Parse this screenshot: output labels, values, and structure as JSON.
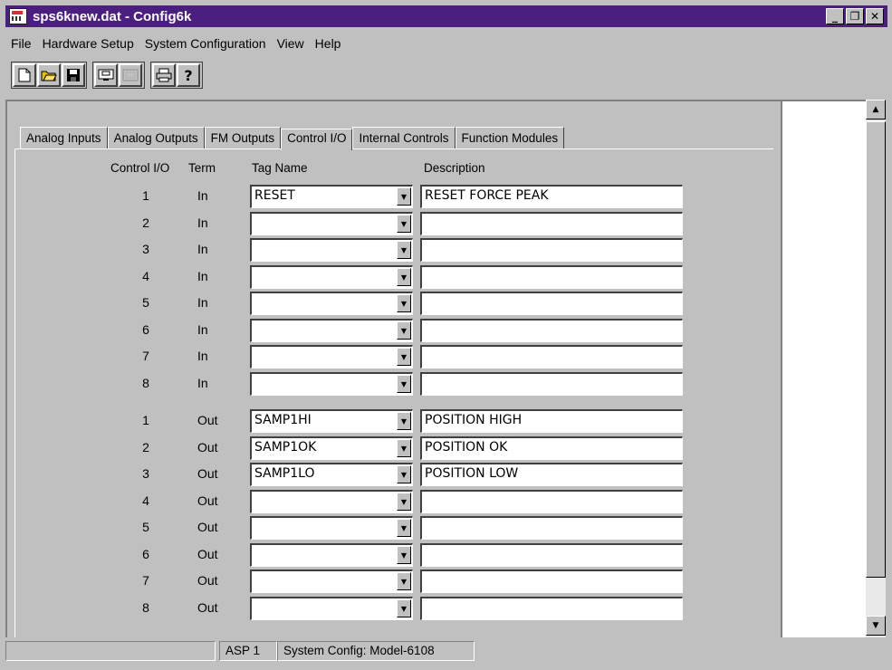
{
  "window": {
    "title": "sps6knew.dat - Config6k",
    "controls": [
      "_",
      "❐",
      "✕"
    ]
  },
  "menu": [
    "File",
    "Hardware Setup",
    "System Configuration",
    "View",
    "Help"
  ],
  "toolbar": {
    "buttons": [
      "new-icon",
      "open-icon",
      "save-icon",
      "monitor-icon",
      "disabled-icon",
      "print-icon",
      "help-icon"
    ]
  },
  "tabs": [
    "Analog Inputs",
    "Analog Outputs",
    "FM Outputs",
    "Control I/O",
    "Internal Controls",
    "Function Modules"
  ],
  "active_tab": "Control I/O",
  "table": {
    "headers": {
      "control": "Control I/O",
      "term": "Term",
      "tag": "Tag Name",
      "description": "Description"
    },
    "rows": [
      {
        "num": "1",
        "term": "In",
        "tag": "RESET",
        "desc": "RESET FORCE PEAK"
      },
      {
        "num": "2",
        "term": "In",
        "tag": "",
        "desc": ""
      },
      {
        "num": "3",
        "term": "In",
        "tag": "",
        "desc": ""
      },
      {
        "num": "4",
        "term": "In",
        "tag": "",
        "desc": ""
      },
      {
        "num": "5",
        "term": "In",
        "tag": "",
        "desc": ""
      },
      {
        "num": "6",
        "term": "In",
        "tag": "",
        "desc": ""
      },
      {
        "num": "7",
        "term": "In",
        "tag": "",
        "desc": ""
      },
      {
        "num": "8",
        "term": "In",
        "tag": "",
        "desc": ""
      },
      {
        "num": "1",
        "term": "Out",
        "tag": "SAMP1HI",
        "desc": "POSITION HIGH"
      },
      {
        "num": "2",
        "term": "Out",
        "tag": "SAMP1OK",
        "desc": "POSITION OK"
      },
      {
        "num": "3",
        "term": "Out",
        "tag": "SAMP1LO",
        "desc": "POSITION LOW"
      },
      {
        "num": "4",
        "term": "Out",
        "tag": "",
        "desc": ""
      },
      {
        "num": "5",
        "term": "Out",
        "tag": "",
        "desc": ""
      },
      {
        "num": "6",
        "term": "Out",
        "tag": "",
        "desc": ""
      },
      {
        "num": "7",
        "term": "Out",
        "tag": "",
        "desc": ""
      },
      {
        "num": "8",
        "term": "Out",
        "tag": "",
        "desc": ""
      }
    ]
  },
  "status": {
    "cell1": "",
    "cell2": "ASP 1",
    "cell3": "System Config: Model-6108"
  }
}
